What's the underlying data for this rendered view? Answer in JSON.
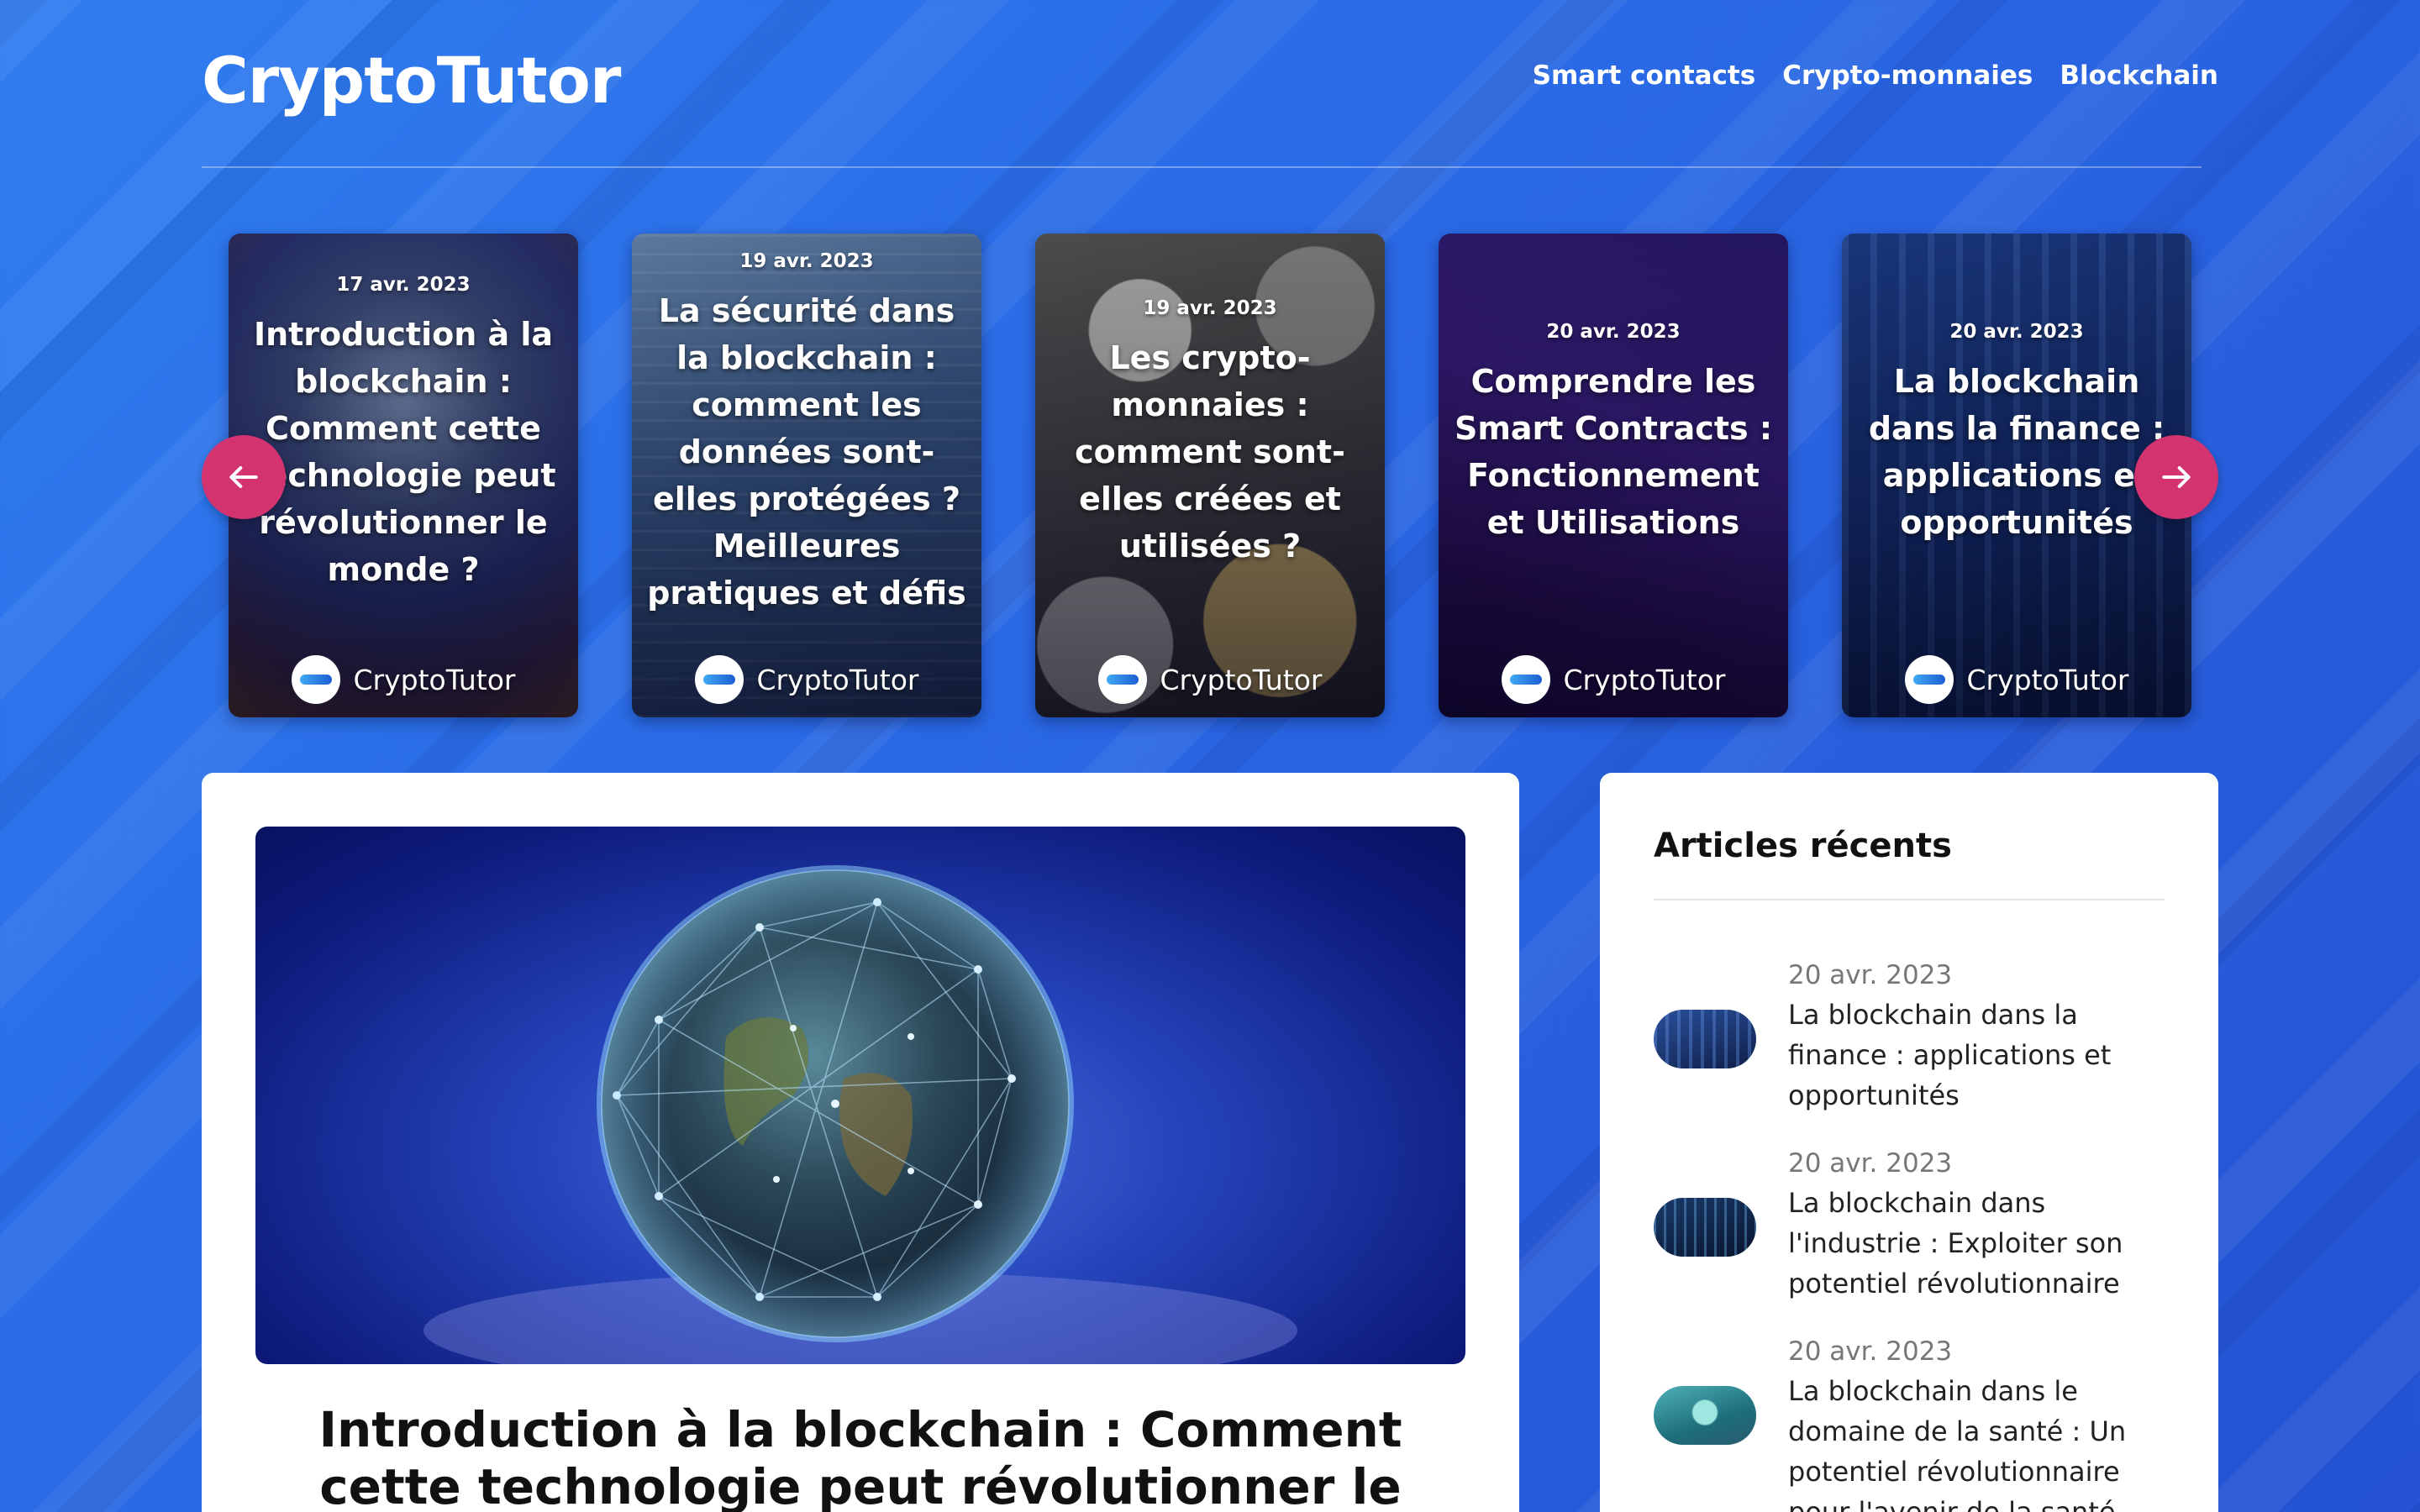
{
  "site": {
    "logo": "CryptoTutor"
  },
  "nav": [
    {
      "label": "Smart contacts"
    },
    {
      "label": "Crypto-monnaies"
    },
    {
      "label": "Blockchain"
    }
  ],
  "carousel": {
    "cards": [
      {
        "date": "17 avr. 2023",
        "title": "Introduction à la blockchain : Comment cette technologie peut révolutionner le monde ?",
        "author": "CryptoTutor"
      },
      {
        "date": "19 avr. 2023",
        "title": "La sécurité dans la blockchain : comment les données sont-elles protégées ? Meilleures pratiques et défis",
        "author": "CryptoTutor"
      },
      {
        "date": "19 avr. 2023",
        "title": "Les crypto-monnaies : comment sont-elles créées et utilisées ?",
        "author": "CryptoTutor"
      },
      {
        "date": "20 avr. 2023",
        "title": "Comprendre les Smart Contracts : Fonctionnement et Utilisations",
        "author": "CryptoTutor"
      },
      {
        "date": "20 avr. 2023",
        "title": "La blockchain dans la finance : applications et opportunités",
        "author": "CryptoTutor"
      }
    ]
  },
  "main": {
    "title": "Introduction à la blockchain : Comment cette technologie peut révolutionner le monde ?"
  },
  "sidebar": {
    "heading": "Articles récents",
    "items": [
      {
        "date": "20 avr. 2023",
        "title": "La blockchain dans la finance : applications et opportunités"
      },
      {
        "date": "20 avr. 2023",
        "title": "La blockchain dans l'industrie : Exploiter son potentiel révolutionnaire"
      },
      {
        "date": "20 avr. 2023",
        "title": "La blockchain dans le domaine de la santé : Un potentiel révolutionnaire pour l'avenir de la santé"
      }
    ]
  },
  "colors": {
    "accent": "#d3336f",
    "background": "#2a6ae6"
  },
  "icons": {
    "prev": "arrow-left-icon",
    "next": "arrow-right-icon"
  }
}
